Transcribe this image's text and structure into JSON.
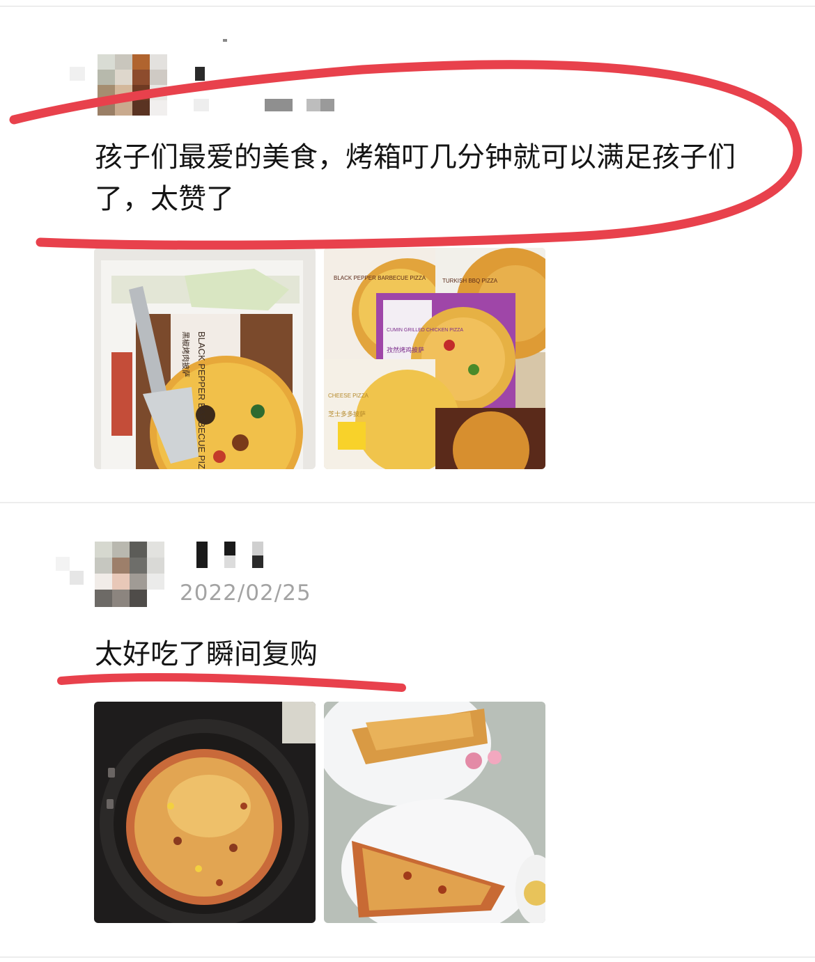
{
  "reviews": [
    {
      "text": "孩子们最爱的美食，烤箱叮几分钟就可以满足孩子们了，太赞了",
      "date": "",
      "photos": [
        {
          "caption": "BLACK PEPPER BARBECUE PIZZA",
          "sub": "黑椒烤肉披萨"
        },
        {
          "caption_a": "BLACK PEPPER BARBECUE PIZZA",
          "caption_b": "TURKISH BBQ PIZZA",
          "caption_c": "CUMIN GRILLED CHICKEN PIZZA",
          "caption_c_sub": "孜然烤鸡披萨",
          "caption_d": "CHEESE PIZZA",
          "caption_d_sub": "芝士多多披萨"
        }
      ]
    },
    {
      "text": "太好吃了瞬间复购",
      "date": "2022/02/25",
      "photos": []
    }
  ],
  "colors": {
    "annotation_red": "#e8414c",
    "date_gray": "#a3a3a3",
    "divider": "#ededed"
  }
}
